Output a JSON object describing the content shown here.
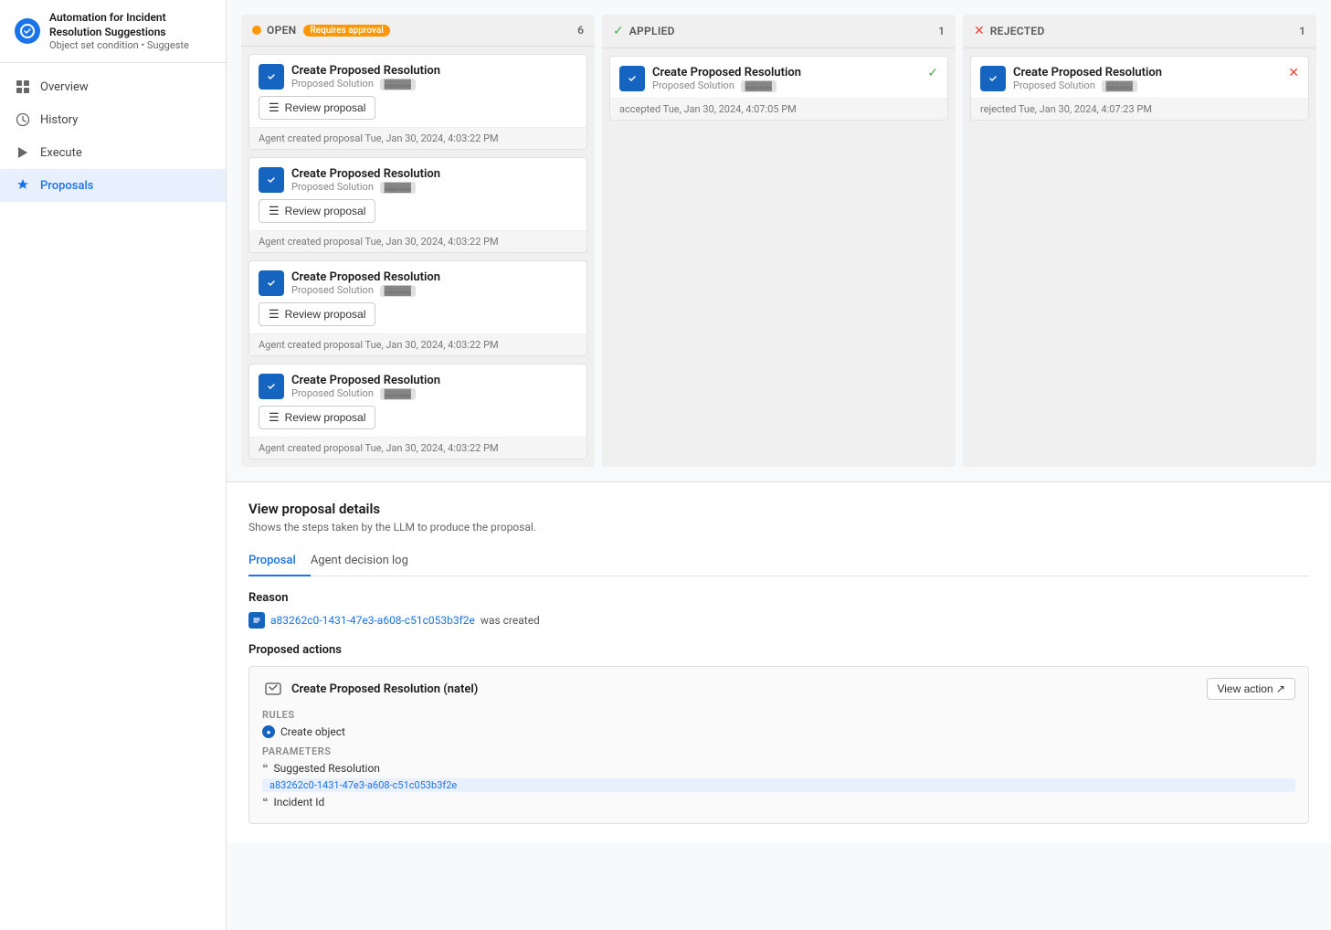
{
  "app": {
    "title": "Automation for Incident Resolution Suggestions",
    "subtitle": "Object set condition • Suggeste",
    "logo_symbol": "⚙"
  },
  "sidebar": {
    "items": [
      {
        "id": "overview",
        "label": "Overview",
        "icon": "▣",
        "active": false
      },
      {
        "id": "history",
        "label": "History",
        "icon": "◷",
        "active": false
      },
      {
        "id": "execute",
        "label": "Execute",
        "icon": "⚡",
        "active": false
      },
      {
        "id": "proposals",
        "label": "Proposals",
        "icon": "✦",
        "active": true
      }
    ]
  },
  "kanban": {
    "columns": [
      {
        "id": "open",
        "status": "OPEN",
        "tag": "Requires approval",
        "count": 6,
        "dot_color": "#ff9800",
        "cards": [
          {
            "title": "Create Proposed Resolution",
            "subtitle": "Proposed Solution",
            "subtitle_tag": "",
            "footer": "Agent created proposal Tue, Jan 30, 2024, 4:03:22 PM",
            "btn": "Review proposal",
            "status_icon": null
          },
          {
            "title": "Create Proposed Resolution",
            "subtitle": "Proposed Solution",
            "subtitle_tag": "",
            "footer": "Agent created proposal Tue, Jan 30, 2024, 4:03:22 PM",
            "btn": "Review proposal",
            "status_icon": null
          },
          {
            "title": "Create Proposed Resolution",
            "subtitle": "Proposed Solution",
            "subtitle_tag": "",
            "footer": "Agent created proposal Tue, Jan 30, 2024, 4:03:22 PM",
            "btn": "Review proposal",
            "status_icon": null
          },
          {
            "title": "Create Proposed Resolution",
            "subtitle": "Proposed Solution",
            "subtitle_tag": "",
            "footer": "Agent created proposal Tue, Jan 30, 2024, 4:03:22 PM",
            "btn": "Review proposal",
            "status_icon": null
          }
        ]
      },
      {
        "id": "applied",
        "status": "APPLIED",
        "count": 1,
        "check": true,
        "cards": [
          {
            "title": "Create Proposed Resolution",
            "subtitle": "Proposed Solution",
            "footer": "accepted Tue, Jan 30, 2024, 4:07:05 PM",
            "status_icon": "check"
          }
        ]
      },
      {
        "id": "rejected",
        "status": "REJECTED",
        "count": 1,
        "x_icon": true,
        "cards": [
          {
            "title": "Create Proposed Resolution",
            "subtitle": "Proposed Solution",
            "footer": "rejected Tue, Jan 30, 2024, 4:07:23 PM",
            "status_icon": "x"
          }
        ]
      }
    ]
  },
  "details": {
    "title": "View proposal details",
    "subtitle": "Shows the steps taken by the LLM to produce the proposal.",
    "tabs": [
      {
        "id": "proposal",
        "label": "Proposal",
        "active": true
      },
      {
        "id": "agent-log",
        "label": "Agent decision log",
        "active": false
      }
    ],
    "reason_section": "Reason",
    "reason_link": "a83262c0-1431-47e3-a608-c51c053b3f2e",
    "reason_suffix": "was created",
    "proposed_actions_label": "Proposed actions",
    "action": {
      "title": "Create Proposed Resolution (natel)",
      "view_btn": "View action ↗",
      "rules_label": "RULES",
      "rule": "Create object",
      "params_label": "PARAMETERS",
      "params": [
        {
          "label": "Suggested Resolution",
          "value": "a83262c0-1431-47e3-a608-c51c053b3f2e"
        },
        {
          "label": "Incident Id",
          "value": ""
        }
      ]
    }
  }
}
